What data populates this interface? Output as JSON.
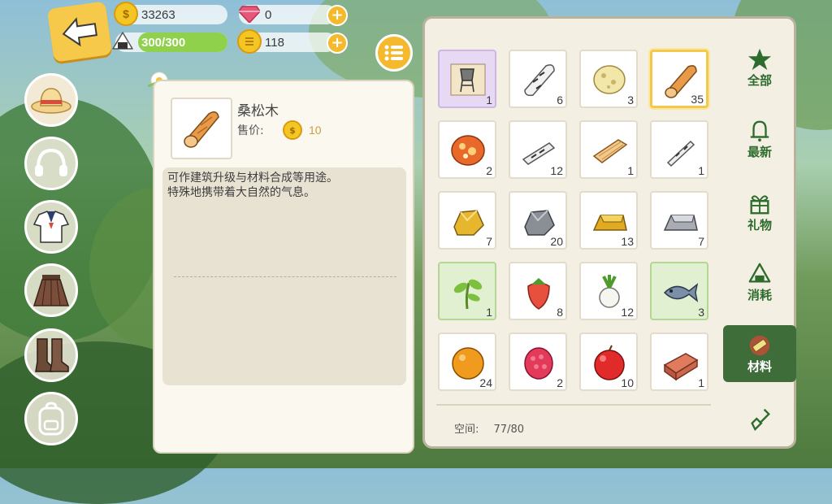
{
  "header": {
    "gold": "33263",
    "gems": "0",
    "stamina": "300/300",
    "stamina_fraction": 1.0,
    "tokens": "118"
  },
  "side_buttons": [
    {
      "name": "hat-button",
      "icon": "straw-hat-icon"
    },
    {
      "name": "headphones-button",
      "icon": "headphones-icon"
    },
    {
      "name": "top-button",
      "icon": "sailor-shirt-icon"
    },
    {
      "name": "skirt-button",
      "icon": "skirt-icon"
    },
    {
      "name": "boots-button",
      "icon": "boots-icon"
    },
    {
      "name": "bag-button",
      "icon": "backpack-icon"
    }
  ],
  "detail": {
    "item_name": "桑松木",
    "price_label": "售价:",
    "price": "10",
    "description_line1": "可作建筑升级与材料合成等用途。",
    "description_line2": "特殊地携带着大自然的气息。"
  },
  "inventory": {
    "items": [
      {
        "icon": "chair-blueprint-icon",
        "count": "1",
        "style": "purple"
      },
      {
        "icon": "birch-log-icon",
        "count": "6",
        "style": "normal"
      },
      {
        "icon": "stone-slab-icon",
        "count": "3",
        "style": "normal"
      },
      {
        "icon": "wood-log-icon",
        "count": "35",
        "style": "selected"
      },
      {
        "icon": "amber-icon",
        "count": "2",
        "style": "normal"
      },
      {
        "icon": "birch-plank-icon",
        "count": "12",
        "style": "normal"
      },
      {
        "icon": "wood-plank-icon",
        "count": "1",
        "style": "normal"
      },
      {
        "icon": "birch-stick-icon",
        "count": "1",
        "style": "normal"
      },
      {
        "icon": "gold-ore-icon",
        "count": "7",
        "style": "normal"
      },
      {
        "icon": "iron-ore-icon",
        "count": "20",
        "style": "normal"
      },
      {
        "icon": "gold-ingot-icon",
        "count": "13",
        "style": "normal"
      },
      {
        "icon": "iron-ingot-icon",
        "count": "7",
        "style": "normal"
      },
      {
        "icon": "sapling-icon",
        "count": "1",
        "style": "green"
      },
      {
        "icon": "strawberry-icon",
        "count": "8",
        "style": "normal"
      },
      {
        "icon": "radish-icon",
        "count": "12",
        "style": "normal"
      },
      {
        "icon": "fish-icon",
        "count": "3",
        "style": "green"
      },
      {
        "icon": "orange-icon",
        "count": "24",
        "style": "normal"
      },
      {
        "icon": "raspberry-icon",
        "count": "2",
        "style": "normal"
      },
      {
        "icon": "apple-icon",
        "count": "10",
        "style": "normal"
      },
      {
        "icon": "brick-icon",
        "count": "1",
        "style": "normal"
      }
    ],
    "space_label": "空间:",
    "space_value": "77/80"
  },
  "tabs": [
    {
      "label": "全部",
      "icon": "star-icon",
      "active": false
    },
    {
      "label": "最新",
      "icon": "bell-icon",
      "active": false
    },
    {
      "label": "礼物",
      "icon": "gift-icon",
      "active": false
    },
    {
      "label": "消耗",
      "icon": "rice-ball-icon",
      "active": false
    },
    {
      "label": "材料",
      "icon": "material-icon",
      "active": true
    },
    {
      "label": "",
      "icon": "shovel-icon",
      "active": false
    }
  ],
  "colors": {
    "accent_yellow": "#f4b92c",
    "tab_green": "#2e6c2e",
    "tab_active_bg": "#3f6d3a",
    "selected_border": "#f2c94c"
  }
}
